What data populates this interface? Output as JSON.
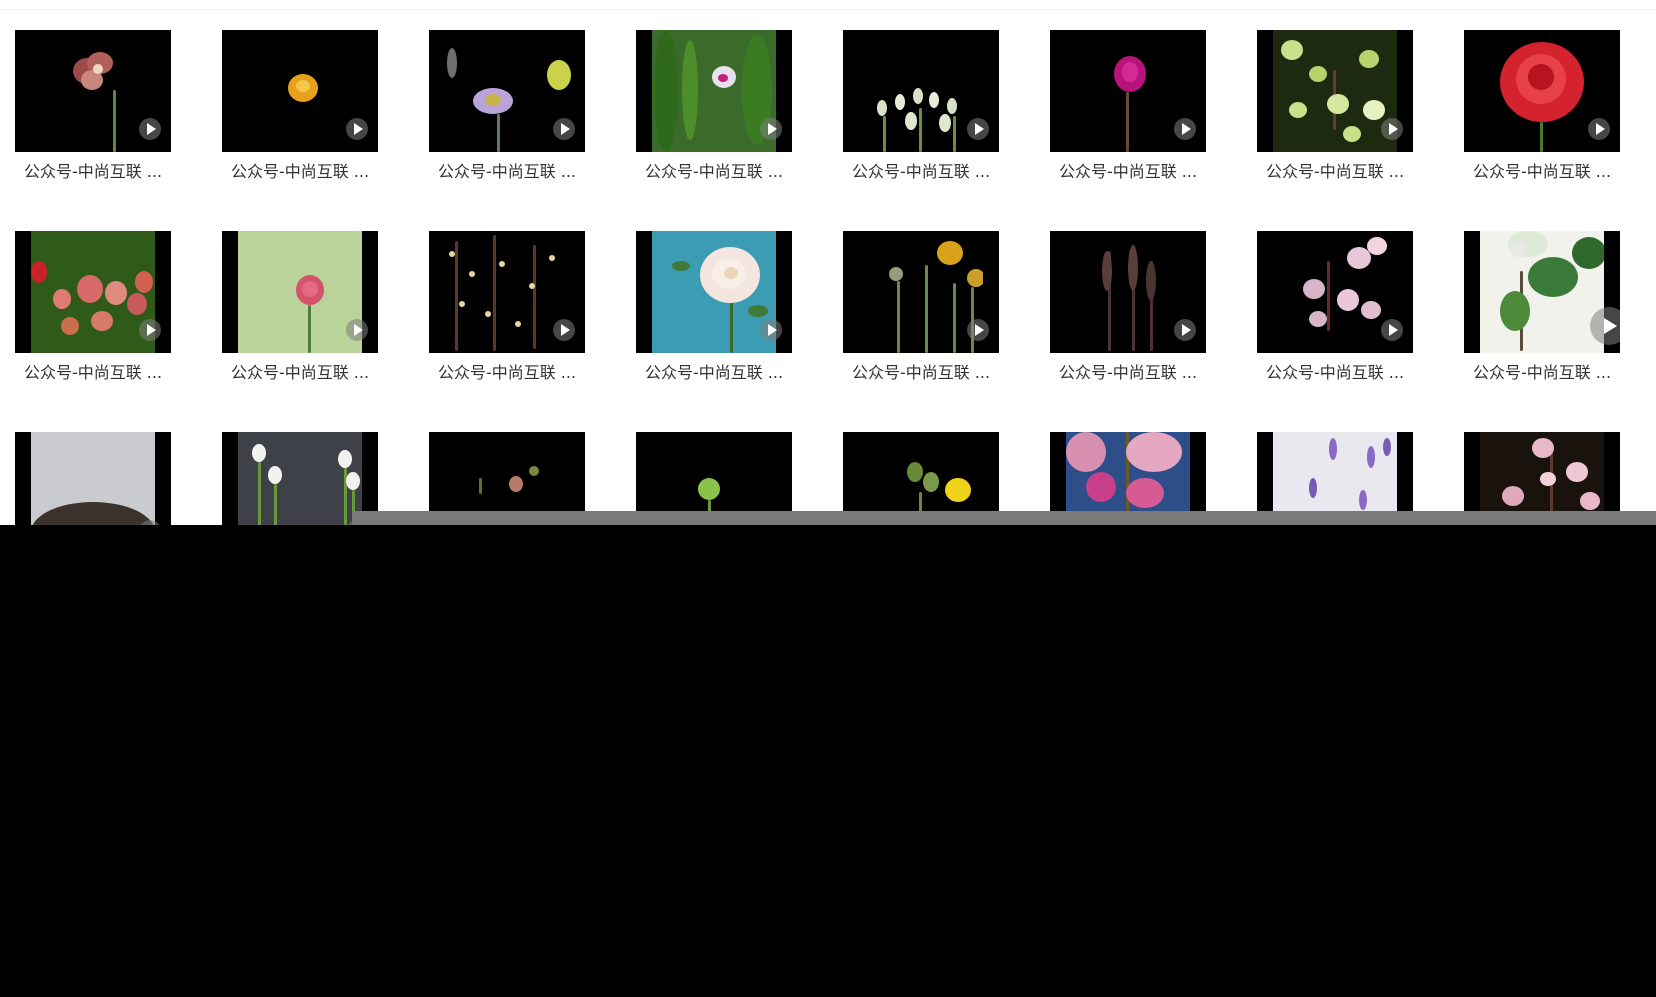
{
  "gallery": {
    "rows": [
      [
        {
          "title": "公众号-中尚互联 ...",
          "icon": "orchid-thumbnail",
          "bg": "#000000"
        },
        {
          "title": "公众号-中尚互联 ...",
          "icon": "yellow-flower-thumbnail",
          "bg": "#000000"
        },
        {
          "title": "公众号-中尚互联 ...",
          "icon": "gerbera-thumbnail",
          "bg": "#000000"
        },
        {
          "title": "公众号-中尚互联 ...",
          "icon": "green-leaves-thumbnail",
          "bg": "#3a6b2a"
        },
        {
          "title": "公众号-中尚互联 ...",
          "icon": "snowdrops-thumbnail",
          "bg": "#000000"
        },
        {
          "title": "公众号-中尚互联 ...",
          "icon": "magenta-flower-thumbnail",
          "bg": "#000000"
        },
        {
          "title": "公众号-中尚互联 ...",
          "icon": "green-buds-thumbnail",
          "bg": "#1d2a10"
        },
        {
          "title": "公众号-中尚互联 ...",
          "icon": "red-rose-thumbnail",
          "bg": "#000000"
        }
      ],
      [
        {
          "title": "公众号-中尚互联 ...",
          "icon": "tulip-buds-thumbnail",
          "bg": "#2f5a1a"
        },
        {
          "title": "公众号-中尚互联 ...",
          "icon": "pink-carnation-thumbnail",
          "bg": "#b9d39a"
        },
        {
          "title": "公众号-中尚互联 ...",
          "icon": "branch-buds-thumbnail",
          "bg": "#000000"
        },
        {
          "title": "公众号-中尚互联 ...",
          "icon": "white-peony-thumbnail",
          "bg": "#3b9cb4"
        },
        {
          "title": "公众号-中尚互联 ...",
          "icon": "dandelions-thumbnail",
          "bg": "#000000"
        },
        {
          "title": "公众号-中尚互联 ...",
          "icon": "dry-stems-thumbnail",
          "bg": "#000000"
        },
        {
          "title": "公众号-中尚互联 ...",
          "icon": "cherry-blossom-thumbnail",
          "bg": "#000000"
        },
        {
          "title": "公众号-中尚互联 ...",
          "icon": "white-blossom-thumbnail",
          "bg": "#f2f2ec"
        }
      ],
      [
        {
          "title": "",
          "icon": "soil-thumbnail",
          "bg": "#c9cbcf"
        },
        {
          "title": "",
          "icon": "snowdrop-stems-thumbnail",
          "bg": "#3f4148"
        },
        {
          "title": "",
          "icon": "curly-branch-thumbnail",
          "bg": "#000000"
        },
        {
          "title": "",
          "icon": "green-bud-thumbnail",
          "bg": "#000000"
        },
        {
          "title": "",
          "icon": "yellow-dandelion-thumbnail",
          "bg": "#000000"
        },
        {
          "title": "",
          "icon": "peach-blossom-thumbnail",
          "bg": "#2e4e8a"
        },
        {
          "title": "",
          "icon": "purple-crocus-snow-thumbnail",
          "bg": "#e8e8ee"
        },
        {
          "title": "",
          "icon": "pink-blossom-branch-thumbnail",
          "bg": "#1a120d"
        }
      ]
    ]
  }
}
